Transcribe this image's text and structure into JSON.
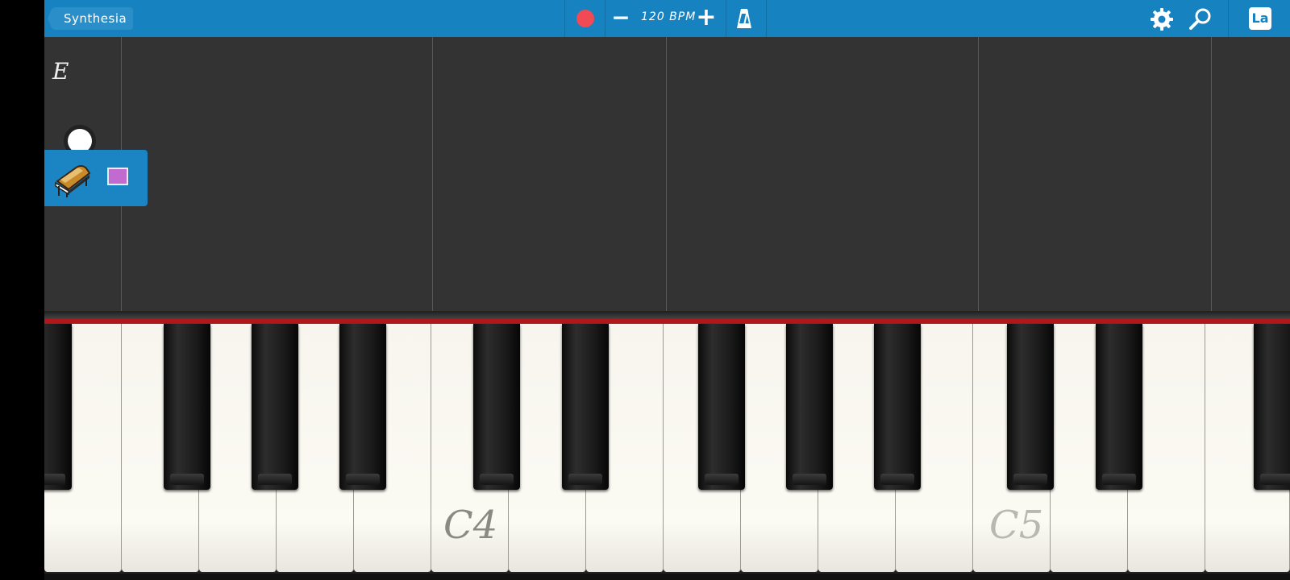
{
  "topbar": {
    "back_label": "Synthesia",
    "bpm_minus": "−",
    "bpm_label": "120 BPM",
    "bpm_plus": "+",
    "label_button": "La"
  },
  "track": {
    "letter": "E",
    "color": "#c36ad0"
  },
  "keyboard": {
    "labels": [
      "C4",
      "C5"
    ]
  },
  "colors": {
    "accent": "#1782c0",
    "record": "#f04a55",
    "keyboard_rail": "#b0181c"
  }
}
